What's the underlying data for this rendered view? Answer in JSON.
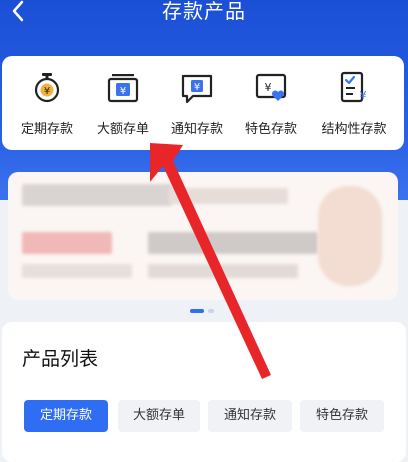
{
  "header": {
    "title": "存款产品"
  },
  "categories": [
    {
      "label": "定期存款",
      "icon": "stopwatch-icon"
    },
    {
      "label": "大额存单",
      "icon": "yen-certificate-icon"
    },
    {
      "label": "通知存款",
      "icon": "yen-message-icon"
    },
    {
      "label": "特色存款",
      "icon": "yen-heart-card-icon"
    },
    {
      "label": "结构性存款",
      "icon": "yen-document-icon"
    }
  ],
  "product_list": {
    "title": "产品列表",
    "tabs": [
      "定期存款",
      "大额存单",
      "通知存款",
      "特色存款"
    ]
  },
  "colors": {
    "primary": "#2f6ef3",
    "header": "#1a4fd6",
    "annotation": "#e8262a"
  }
}
